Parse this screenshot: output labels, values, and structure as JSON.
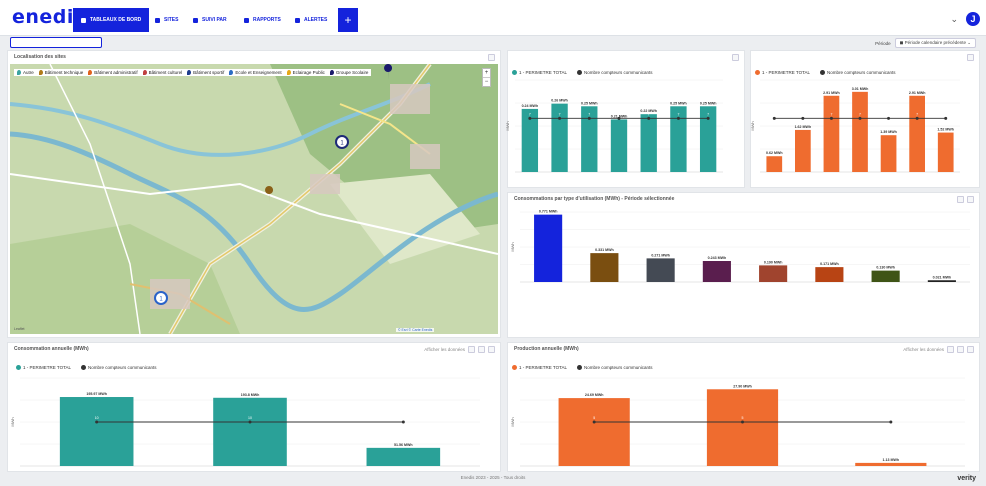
{
  "app": {
    "logo": "enedis"
  },
  "nav": {
    "items": [
      {
        "label": "TABLEAUX DE BORD",
        "active": true
      },
      {
        "label": "SITES",
        "active": false
      },
      {
        "label": "SUIVI PAR",
        "active": false
      },
      {
        "label": "RAPPORTS",
        "active": false
      },
      {
        "label": "ALERTES",
        "active": false
      }
    ],
    "add_label": "+",
    "user_initial": "J"
  },
  "search": {
    "placeholder": ""
  },
  "period": {
    "label": "Période",
    "value": "Période calendaire précédente"
  },
  "map_panel": {
    "title": "Localisation des sites",
    "legend": [
      {
        "label": "Autre",
        "color": "#3ba3a0"
      },
      {
        "label": "Bâtiment technique",
        "color": "#b07a1a"
      },
      {
        "label": "Bâtiment administratif",
        "color": "#e0621d"
      },
      {
        "label": "Bâtiment culturel",
        "color": "#c04040"
      },
      {
        "label": "Bâtiment sportif",
        "color": "#1e3c8c"
      },
      {
        "label": "Ecole et Enseignement",
        "color": "#2b6cc4"
      },
      {
        "label": "Eclairage Public",
        "color": "#e6a817"
      },
      {
        "label": "Groupe Scolaire",
        "color": "#1a1a6c"
      }
    ],
    "zoom_in": "+",
    "zoom_out": "−",
    "attribution": "© Esri © Carte Enedis",
    "leaflet": "Leaflet"
  },
  "colors": {
    "teal": "#2aa198",
    "orange": "#ef6c2f",
    "dark_line": "#333333",
    "blue": "#1423dc",
    "brown": "#7a4e10",
    "charcoal": "#444a54",
    "purple": "#5a1e4e",
    "rust": "#a0442e",
    "darkorange": "#b84414",
    "olive": "#3f5416",
    "black": "#222222"
  },
  "chart_data": [
    {
      "type": "bar",
      "title": "",
      "series": [
        {
          "name": "1 - PERIMETRE TOTAL",
          "values": [
            0.24,
            0.26,
            0.25,
            0.2,
            0.22,
            0.25,
            0.25
          ]
        },
        {
          "name": "Nombre compteurs communicants",
          "values": [
            7,
            7,
            7,
            7,
            7,
            7,
            7
          ]
        }
      ],
      "categories": [
        "",
        "",
        "",
        "",
        "",
        "",
        ""
      ],
      "bar_labels": [
        "0.24 MWh",
        "0.26 MWh",
        "0.25 MWh",
        "0.21 MWh",
        "0.22 MWh",
        "0.25 MWh",
        "0.25 MWh"
      ],
      "ylim": [
        0,
        0.35
      ],
      "y2lim": [
        0,
        12
      ],
      "ylabel": "MWh"
    },
    {
      "type": "bar",
      "title": "",
      "series": [
        {
          "name": "1 - PERIMETRE TOTAL",
          "values": [
            0.6,
            1.6,
            2.9,
            3.05,
            1.4,
            2.9,
            1.5
          ]
        },
        {
          "name": "Nombre compteurs communicants",
          "values": [
            7,
            7,
            7,
            7,
            7,
            7,
            7
          ]
        }
      ],
      "categories": [
        "",
        "",
        "",
        "",
        "",
        "",
        ""
      ],
      "bar_labels": [
        "0.62 MWh",
        "1.62 MWh",
        "2.91 MWh",
        "3.01 MWh",
        "1.39 MWh",
        "2.91 MWh",
        "1.52 MWh"
      ],
      "ylim": [
        0,
        3.5
      ],
      "y2lim": [
        0,
        12
      ],
      "ylabel": "MWh"
    },
    {
      "type": "bar",
      "title": "Consommations par type d'utilisation (MWh) - Période sélectionnée",
      "categories": [
        "",
        "",
        "",
        "",
        "",
        "",
        "",
        ""
      ],
      "values": [
        0.77,
        0.33,
        0.27,
        0.24,
        0.19,
        0.17,
        0.13,
        0.02
      ],
      "bar_labels": [
        "0.771 MWh",
        "0.331 MWh",
        "0.271 MWh",
        "0.243 MWh",
        "0.190 MWh",
        "0.171 MWh",
        "0.130 MWh",
        "0.021 MWh"
      ],
      "ylim": [
        0,
        0.8
      ],
      "ylabel": "MWh"
    },
    {
      "type": "bar",
      "title": "Consommation annuelle (MWh)",
      "categories": [
        "",
        "",
        ""
      ],
      "series": [
        {
          "name": "1 - PERIMETRE TOTAL",
          "values": [
            195.97,
            193.8,
            51.56
          ]
        },
        {
          "name": "Nombre compteurs communicants",
          "values": [
            10,
            10,
            10
          ]
        }
      ],
      "bar_labels": [
        "195.97 MWh",
        "193.8 MWh",
        "51.56 MWh"
      ],
      "ylim": [
        0,
        250
      ],
      "y2lim": [
        0,
        20
      ],
      "ylabel": "MWh"
    },
    {
      "type": "bar",
      "title": "Production annuelle (MWh)",
      "categories": [
        "",
        "",
        ""
      ],
      "series": [
        {
          "name": "1 - PERIMETRE TOTAL",
          "values": [
            24.69,
            27.9,
            1.13
          ]
        },
        {
          "name": "Nombre compteurs communicants",
          "values": [
            5,
            5,
            5
          ]
        }
      ],
      "bar_labels": [
        "24.69 MWh",
        "27.90 MWh",
        "1.13 MWh"
      ],
      "ylim": [
        0,
        32
      ],
      "y2lim": [
        0,
        10
      ],
      "ylabel": "MWh"
    }
  ],
  "footer": {
    "text": "Enedis 2023 - 2025 - Tous droits",
    "brand": "verity"
  },
  "panel_tools": {
    "display_label": "Afficher les données"
  }
}
